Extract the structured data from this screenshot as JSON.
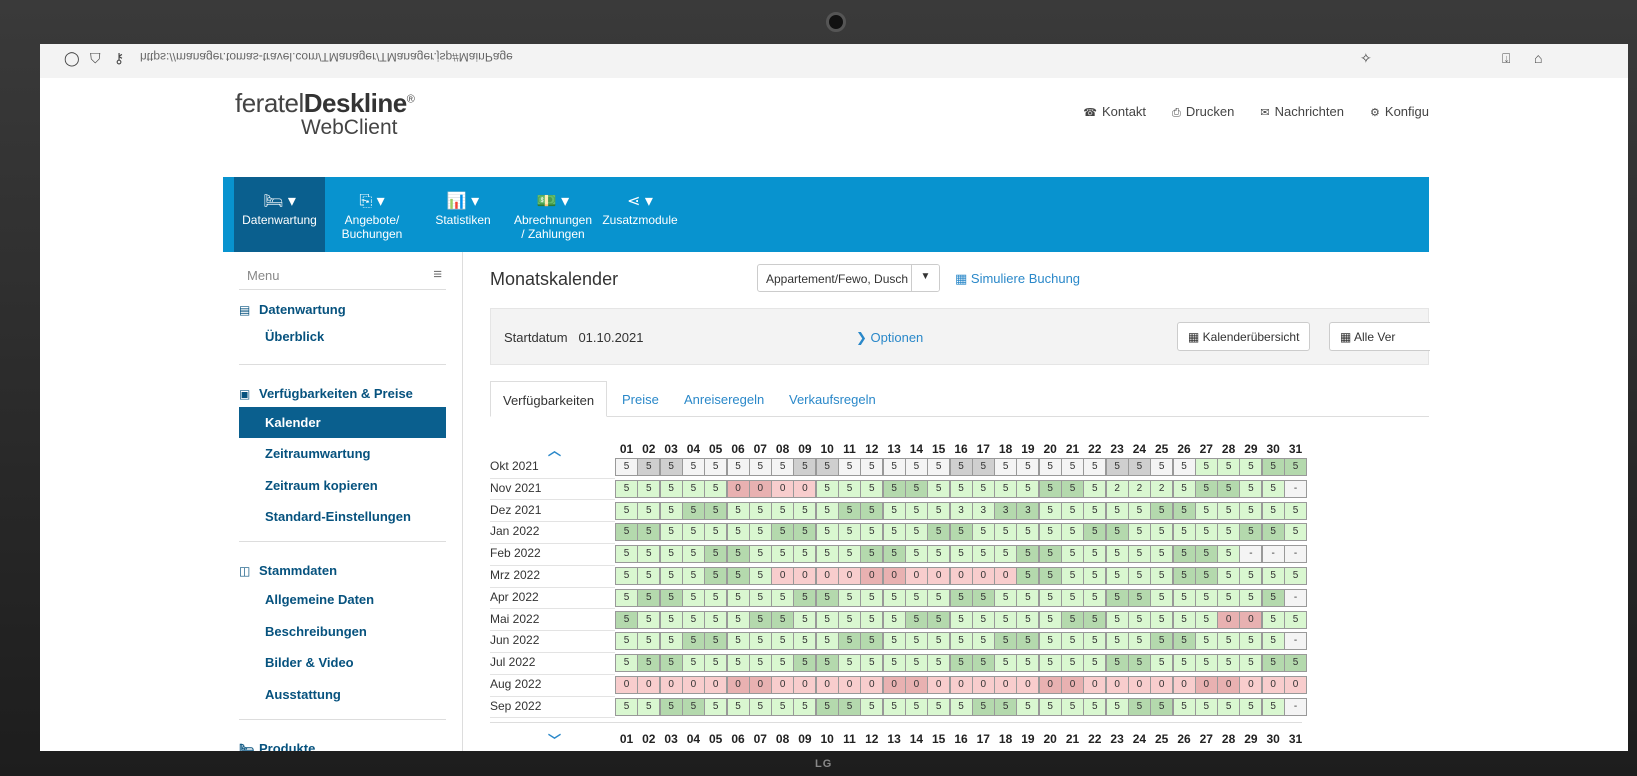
{
  "browser": {
    "url": "https://manager.tomas-travel.com/TManager/TManager.jsp#MainPage"
  },
  "brand": {
    "line1_a": "feratel",
    "line1_b": "Deskline",
    "reg": "®",
    "line2": "WebClient"
  },
  "toplinks": [
    {
      "icon": "phone-icon",
      "glyph": "☎",
      "label": "Kontakt"
    },
    {
      "icon": "print-icon",
      "glyph": "⎙",
      "label": "Drucken"
    },
    {
      "icon": "envelope-icon",
      "glyph": "✉",
      "label": "Nachrichten"
    },
    {
      "icon": "gear-icon",
      "glyph": "⚙",
      "label": "Konfigu"
    }
  ],
  "mainnav": [
    {
      "glyph": "🛏 ▾",
      "line1": "Datenwartung",
      "line2": "",
      "active": true
    },
    {
      "glyph": "⎘ ▾",
      "line1": "Angebote/",
      "line2": "Buchungen",
      "active": false
    },
    {
      "glyph": "📊 ▾",
      "line1": "Statistiken",
      "line2": "",
      "active": false
    },
    {
      "glyph": "💵 ▾",
      "line1": "Abrechnungen",
      "line2": "/ Zahlungen",
      "active": false
    },
    {
      "glyph": "⋖ ▾",
      "line1": "Zusatzmodule",
      "line2": "",
      "active": false
    }
  ],
  "sidebar": {
    "menu_label": "Menu",
    "sections": [
      {
        "title": "Datenwartung",
        "glyph": "▤",
        "items": [
          "Überblick"
        ]
      },
      {
        "title": "Verfügbarkeiten & Preise",
        "glyph": "▣",
        "items": [
          "Kalender",
          "Zeitraumwartung",
          "Zeitraum kopieren",
          "Standard-Einstellungen"
        ]
      },
      {
        "title": "Stammdaten",
        "glyph": "◫",
        "items": [
          "Allgemeine Daten",
          "Beschreibungen",
          "Bilder & Video",
          "Ausstattung"
        ]
      },
      {
        "title": "Produkte",
        "glyph": "🛏",
        "items": []
      }
    ],
    "active_item": "Kalender"
  },
  "page": {
    "title": "Monatskalender",
    "select_value": "Appartement/Fewo, Dusch",
    "simulate_label": "Simuliere Buchung",
    "start_label": "Startdatum",
    "start_value": "01.10.2021",
    "options_label": "Optionen",
    "btn_overview": "Kalenderübersicht",
    "btn_all": "Alle Ver",
    "tabs": [
      "Verfügbarkeiten",
      "Preise",
      "Anreiseregeln",
      "Verkaufsregeln"
    ],
    "active_tab": "Verfügbarkeiten"
  },
  "calendar": {
    "days": [
      "01",
      "02",
      "03",
      "04",
      "05",
      "06",
      "07",
      "08",
      "09",
      "10",
      "11",
      "12",
      "13",
      "14",
      "15",
      "16",
      "17",
      "18",
      "19",
      "20",
      "21",
      "22",
      "23",
      "24",
      "25",
      "26",
      "27",
      "28",
      "29",
      "30",
      "31"
    ],
    "rows": [
      {
        "month": "Okt 2021",
        "values": [
          "5",
          "5",
          "5",
          "5",
          "5",
          "5",
          "5",
          "5",
          "5",
          "5",
          "5",
          "5",
          "5",
          "5",
          "5",
          "5",
          "5",
          "5",
          "5",
          "5",
          "5",
          "5",
          "5",
          "5",
          "5",
          "5",
          "5",
          "5",
          "5",
          "5",
          "5"
        ],
        "weekend": [
          2,
          3,
          9,
          10,
          16,
          17,
          23,
          24,
          30,
          31
        ],
        "green_from": 27
      },
      {
        "month": "Nov 2021",
        "values": [
          "5",
          "5",
          "5",
          "5",
          "5",
          "0",
          "0",
          "0",
          "0",
          "5",
          "5",
          "5",
          "5",
          "5",
          "5",
          "5",
          "5",
          "5",
          "5",
          "5",
          "5",
          "5",
          "2",
          "2",
          "2",
          "5",
          "5",
          "5",
          "5",
          "5",
          "-"
        ],
        "weekend": [
          6,
          7,
          13,
          14,
          20,
          21,
          27,
          28
        ]
      },
      {
        "month": "Dez 2021",
        "values": [
          "5",
          "5",
          "5",
          "5",
          "5",
          "5",
          "5",
          "5",
          "5",
          "5",
          "5",
          "5",
          "5",
          "5",
          "5",
          "3",
          "3",
          "3",
          "3",
          "5",
          "5",
          "5",
          "5",
          "5",
          "5",
          "5",
          "5",
          "5",
          "5",
          "5",
          "5"
        ],
        "weekend": [
          4,
          5,
          11,
          12,
          18,
          19,
          25,
          26
        ]
      },
      {
        "month": "Jan 2022",
        "values": [
          "5",
          "5",
          "5",
          "5",
          "5",
          "5",
          "5",
          "5",
          "5",
          "5",
          "5",
          "5",
          "5",
          "5",
          "5",
          "5",
          "5",
          "5",
          "5",
          "5",
          "5",
          "5",
          "5",
          "5",
          "5",
          "5",
          "5",
          "5",
          "5",
          "5",
          "5"
        ],
        "weekend": [
          1,
          2,
          8,
          9,
          15,
          16,
          22,
          23,
          29,
          30
        ]
      },
      {
        "month": "Feb 2022",
        "values": [
          "5",
          "5",
          "5",
          "5",
          "5",
          "5",
          "5",
          "5",
          "5",
          "5",
          "5",
          "5",
          "5",
          "5",
          "5",
          "5",
          "5",
          "5",
          "5",
          "5",
          "5",
          "5",
          "5",
          "5",
          "5",
          "5",
          "5",
          "5",
          "-",
          "-",
          "-"
        ],
        "weekend": [
          5,
          6,
          12,
          13,
          19,
          20,
          26,
          27
        ]
      },
      {
        "month": "Mrz 2022",
        "values": [
          "5",
          "5",
          "5",
          "5",
          "5",
          "5",
          "5",
          "0",
          "0",
          "0",
          "0",
          "0",
          "0",
          "0",
          "0",
          "0",
          "0",
          "0",
          "5",
          "5",
          "5",
          "5",
          "5",
          "5",
          "5",
          "5",
          "5",
          "5",
          "5",
          "5",
          "5"
        ],
        "weekend": [
          5,
          6,
          12,
          13,
          19,
          20,
          26,
          27
        ]
      },
      {
        "month": "Apr 2022",
        "values": [
          "5",
          "5",
          "5",
          "5",
          "5",
          "5",
          "5",
          "5",
          "5",
          "5",
          "5",
          "5",
          "5",
          "5",
          "5",
          "5",
          "5",
          "5",
          "5",
          "5",
          "5",
          "5",
          "5",
          "5",
          "5",
          "5",
          "5",
          "5",
          "5",
          "5",
          "-"
        ],
        "weekend": [
          2,
          3,
          9,
          10,
          16,
          17,
          23,
          24,
          30
        ]
      },
      {
        "month": "Mai 2022",
        "values": [
          "5",
          "5",
          "5",
          "5",
          "5",
          "5",
          "5",
          "5",
          "5",
          "5",
          "5",
          "5",
          "5",
          "5",
          "5",
          "5",
          "5",
          "5",
          "5",
          "5",
          "5",
          "5",
          "5",
          "5",
          "5",
          "5",
          "5",
          "0",
          "0",
          "5",
          "5"
        ],
        "weekend": [
          1,
          7,
          8,
          14,
          15,
          21,
          22,
          28,
          29
        ]
      },
      {
        "month": "Jun 2022",
        "values": [
          "5",
          "5",
          "5",
          "5",
          "5",
          "5",
          "5",
          "5",
          "5",
          "5",
          "5",
          "5",
          "5",
          "5",
          "5",
          "5",
          "5",
          "5",
          "5",
          "5",
          "5",
          "5",
          "5",
          "5",
          "5",
          "5",
          "5",
          "5",
          "5",
          "5",
          "-"
        ],
        "weekend": [
          4,
          5,
          11,
          12,
          18,
          19,
          25,
          26
        ]
      },
      {
        "month": "Jul 2022",
        "values": [
          "5",
          "5",
          "5",
          "5",
          "5",
          "5",
          "5",
          "5",
          "5",
          "5",
          "5",
          "5",
          "5",
          "5",
          "5",
          "5",
          "5",
          "5",
          "5",
          "5",
          "5",
          "5",
          "5",
          "5",
          "5",
          "5",
          "5",
          "5",
          "5",
          "5",
          "5"
        ],
        "weekend": [
          2,
          3,
          9,
          10,
          16,
          17,
          23,
          24,
          30,
          31
        ]
      },
      {
        "month": "Aug 2022",
        "values": [
          "0",
          "0",
          "0",
          "0",
          "0",
          "0",
          "0",
          "0",
          "0",
          "0",
          "0",
          "0",
          "0",
          "0",
          "0",
          "0",
          "0",
          "0",
          "0",
          "0",
          "0",
          "0",
          "0",
          "0",
          "0",
          "0",
          "0",
          "0",
          "0",
          "0",
          "0"
        ],
        "weekend": [
          6,
          7,
          13,
          14,
          20,
          21,
          27,
          28
        ]
      },
      {
        "month": "Sep 2022",
        "values": [
          "5",
          "5",
          "5",
          "5",
          "5",
          "5",
          "5",
          "5",
          "5",
          "5",
          "5",
          "5",
          "5",
          "5",
          "5",
          "5",
          "5",
          "5",
          "5",
          "5",
          "5",
          "5",
          "5",
          "5",
          "5",
          "5",
          "5",
          "5",
          "5",
          "5",
          "-"
        ],
        "weekend": [
          3,
          4,
          10,
          11,
          17,
          18,
          24,
          25
        ]
      }
    ]
  },
  "device": {
    "brand": "LG"
  }
}
